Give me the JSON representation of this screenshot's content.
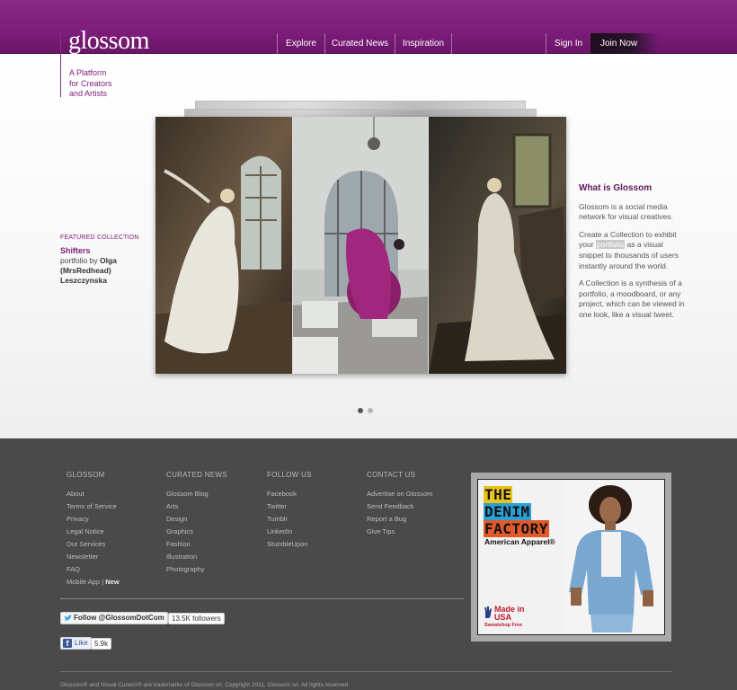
{
  "header": {
    "logo": "glossom",
    "nav": [
      "Explore",
      "Curated News",
      "Inspiration"
    ],
    "sign_in": "Sign In",
    "join": "Join Now",
    "tagline": [
      "A Platform",
      "for Creators",
      "and Artists"
    ]
  },
  "featured": {
    "label": "FEATURED COLLECTION",
    "title": "Shifters",
    "portfolio_by": "portfolio by",
    "author": "Olga (MrsRedhead) Leszczynska"
  },
  "slideshow": {
    "dots_total": 2,
    "dot_active": 1
  },
  "about": {
    "heading": "What is Glossom",
    "p1": "Glossom is a social media network for visual creatives.",
    "p2_before": "Create a Collection to exhibit your",
    "p2_highlight": "portfolio",
    "p2_after": "as a visual snippet to thousands of users instantly around the world.",
    "p3": "A Collection is a synthesis of a portfolio, a moodboard, or any project, which can be viewed in one look, like a visual tweet."
  },
  "footer": {
    "columns": [
      {
        "heading": "GLOSSOM",
        "items": [
          "About",
          "Terms of Service",
          "Privacy",
          "Legal Notice",
          "Our Services",
          "Newsletter",
          "FAQ",
          "Mobile App"
        ],
        "extra": "New"
      },
      {
        "heading": "CURATED NEWS",
        "items": [
          "Glossom Blog",
          "Arts",
          "Design",
          "Graphics",
          "Fashion",
          "Illustration",
          "Photography"
        ]
      },
      {
        "heading": "FOLLOW US",
        "items": [
          "Facebook",
          "Twitter",
          "Tumblr",
          "LinkedIn",
          "StumbleUpon"
        ]
      },
      {
        "heading": "CONTACT US",
        "items": [
          "Advertise on Glossom",
          "Send Feedback",
          "Report a Bug",
          "Give Tips"
        ]
      }
    ],
    "twitter_follow": "Follow @GlossomDotCom",
    "twitter_count": "13.5K followers",
    "fb_like": "Like",
    "fb_count": "5.9k",
    "copyright": "Glossom® and Visual Curator® are trademarks of Glossom srl, Copyright 2011, Glossom srl. All rights reserved"
  },
  "ad": {
    "line1": "THE",
    "line2": "DENIM",
    "line3": "FACTORY",
    "brand": "American Apparel®",
    "made": "Made in USA",
    "made_sub": "Sweatshop Free"
  }
}
